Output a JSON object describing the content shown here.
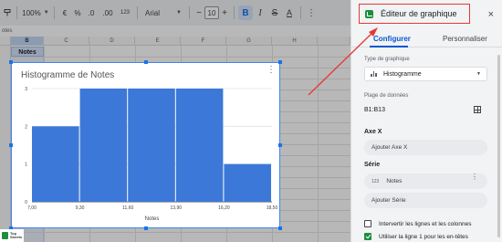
{
  "toolbar": {
    "zoom": "100%",
    "currency": "€",
    "percent": "%",
    "dec_less": ".0",
    "dec_more": ".00",
    "format_num": "123",
    "font": "Arial",
    "font_size": "10",
    "bold": "B",
    "italic": "I",
    "strike": "S",
    "text_color": "A"
  },
  "formula_bar": {
    "cell_ref": "otes"
  },
  "sheet": {
    "columns": [
      "B",
      "C",
      "D",
      "E",
      "F",
      "G",
      "H"
    ],
    "selected_column": "B",
    "header_cell": "Notes"
  },
  "logo": {
    "text_line1": "Top",
    "text_line2": "Sheets"
  },
  "chart_data": {
    "type": "bar",
    "title": "Histogramme de Notes",
    "xlabel": "Notes",
    "ylabel": "",
    "bins": [
      "7,00",
      "9,30",
      "11,60",
      "13,90",
      "16,20",
      "18,50"
    ],
    "values": [
      2,
      3,
      3,
      3,
      1
    ],
    "y_ticks": [
      "0",
      "1",
      "2",
      "3"
    ],
    "ylim": [
      0,
      3
    ],
    "bar_color": "#3c78d8",
    "grid": true
  },
  "panel": {
    "title": "Éditeur de graphique",
    "close_label": "×",
    "tabs": [
      "Configurer",
      "Personnaliser"
    ],
    "chart_type_label": "Type de graphique",
    "chart_type_value": "Histogramme",
    "data_range_label": "Plage de données",
    "data_range_value": "B1:B13",
    "x_axis_label": "Axe X",
    "x_axis_add": "Ajouter Axe X",
    "series_label": "Série",
    "series_icon": "123",
    "series_value": "Notes",
    "series_add": "Ajouter Série",
    "option_switch": "Intervertir les lignes et les colonnes",
    "option_headers": "Utiliser la ligne 1 pour les en-têtes",
    "option_headers_checked": true,
    "option_switch_checked": false
  },
  "colors": {
    "accent": "#0b57d0",
    "highlight_red": "#e53935",
    "bar": "#3c78d8",
    "green_icon": "#1e8e3e"
  }
}
